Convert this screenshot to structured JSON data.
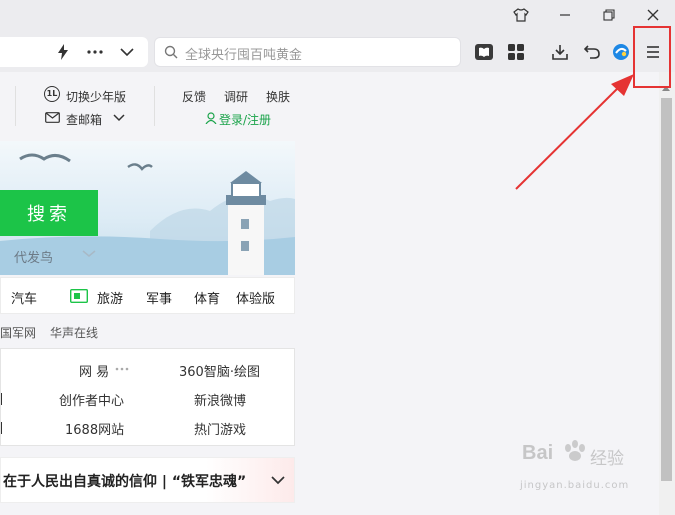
{
  "toolbar": {
    "search_placeholder": "全球央行囤百吨黄金"
  },
  "header_links": {
    "kids_mode": "切换少年版",
    "kids_badge": "1L",
    "mail": "查邮箱",
    "feedback": "反馈",
    "survey": "调研",
    "skin": "换肤",
    "login": "登录/注册"
  },
  "search_panel": {
    "button": "搜索",
    "hint": "代发鸟"
  },
  "categories": [
    "汽车",
    "旅游",
    "军事",
    "体育",
    "体验版"
  ],
  "small_links": [
    "国军网",
    "华声在线"
  ],
  "grid": {
    "row1": [
      "网 易",
      "360智脑·绘图"
    ],
    "row2": [
      "创作者中心",
      "新浪微博"
    ],
    "row3": [
      "1688网站",
      "热门游戏"
    ]
  },
  "news": {
    "headline": "在于人民出自真诚的信仰 | “铁军忠魂”"
  },
  "watermark": {
    "brand": "Bai",
    "brand2": "经验",
    "url": "jingyan.baidu.com"
  },
  "colors": {
    "accent_green": "#1cc448",
    "annotation_red": "#e53333"
  }
}
